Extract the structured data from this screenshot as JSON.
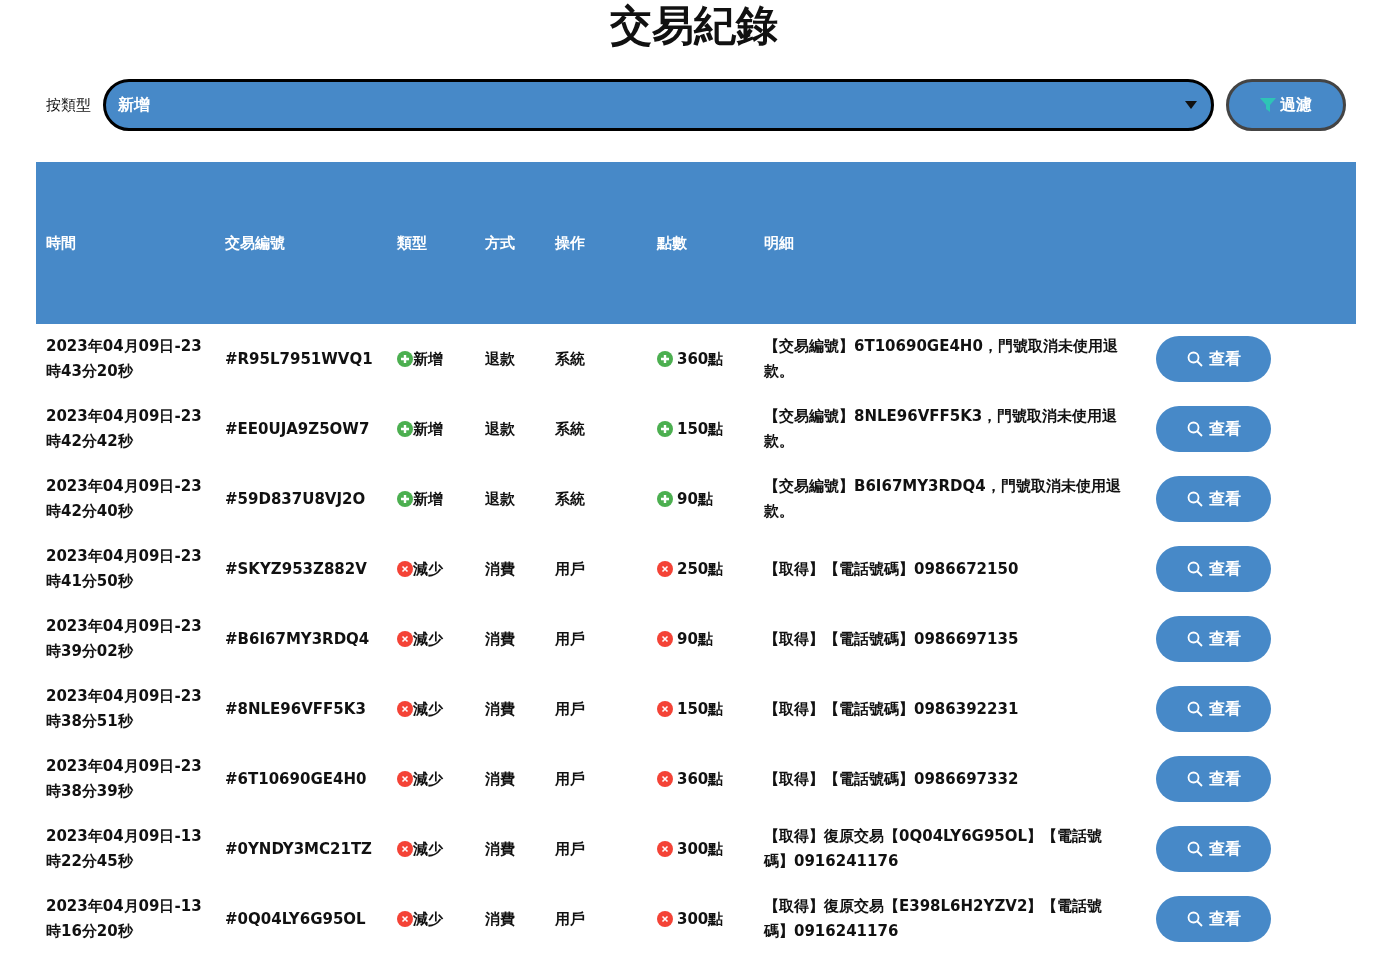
{
  "title": "交易紀錄",
  "filter": {
    "label": "按類型",
    "value": "新增",
    "button": "過濾"
  },
  "table": {
    "columns": [
      "時間",
      "交易編號",
      "類型",
      "方式",
      "操作",
      "點數",
      "明細"
    ],
    "rows": [
      {
        "time_1": "2023年04月09日-23",
        "time_2": "時43分20秒",
        "id": "#R95L7951WVQ1",
        "kind": "add",
        "type": "新增",
        "method": "退款",
        "operator": "系統",
        "points": "360點",
        "detail": "【交易編號】6T10690GE4H0，門號取消未使用退款。",
        "action": "查看"
      },
      {
        "time_1": "2023年04月09日-23",
        "time_2": "時42分42秒",
        "id": "#EE0UJA9Z5OW7",
        "kind": "add",
        "type": "新增",
        "method": "退款",
        "operator": "系統",
        "points": "150點",
        "detail": "【交易編號】8NLE96VFF5K3，門號取消未使用退款。",
        "action": "查看"
      },
      {
        "time_1": "2023年04月09日-23",
        "time_2": "時42分40秒",
        "id": "#59D837U8VJ2O",
        "kind": "add",
        "type": "新增",
        "method": "退款",
        "operator": "系統",
        "points": "90點",
        "detail": "【交易編號】B6I67MY3RDQ4，門號取消未使用退款。",
        "action": "查看"
      },
      {
        "time_1": "2023年04月09日-23",
        "time_2": "時41分50秒",
        "id": "#SKYZ953Z882V",
        "kind": "subtract",
        "type": "減少",
        "method": "消費",
        "operator": "用戶",
        "points": "250點",
        "detail": "【取得】【電話號碼】0986672150",
        "action": "查看"
      },
      {
        "time_1": "2023年04月09日-23",
        "time_2": "時39分02秒",
        "id": "#B6I67MY3RDQ4",
        "kind": "subtract",
        "type": "減少",
        "method": "消費",
        "operator": "用戶",
        "points": "90點",
        "detail": "【取得】【電話號碼】0986697135",
        "action": "查看"
      },
      {
        "time_1": "2023年04月09日-23",
        "time_2": "時38分51秒",
        "id": "#8NLE96VFF5K3",
        "kind": "subtract",
        "type": "減少",
        "method": "消費",
        "operator": "用戶",
        "points": "150點",
        "detail": "【取得】【電話號碼】0986392231",
        "action": "查看"
      },
      {
        "time_1": "2023年04月09日-23",
        "time_2": "時38分39秒",
        "id": "#6T10690GE4H0",
        "kind": "subtract",
        "type": "減少",
        "method": "消費",
        "operator": "用戶",
        "points": "360點",
        "detail": "【取得】【電話號碼】0986697332",
        "action": "查看"
      },
      {
        "time_1": "2023年04月09日-13",
        "time_2": "時22分45秒",
        "id": "#0YNDY3MC21TZ",
        "kind": "subtract",
        "type": "減少",
        "method": "消費",
        "operator": "用戶",
        "points": "300點",
        "detail": "【取得】復原交易【0Q04LY6G95OL】【電話號碼】0916241176",
        "action": "查看"
      },
      {
        "time_1": "2023年04月09日-13",
        "time_2": "時16分20秒",
        "id": "#0Q04LY6G95OL",
        "kind": "subtract",
        "type": "減少",
        "method": "消費",
        "operator": "用戶",
        "points": "300點",
        "detail": "【取得】復原交易【E398L6H2YZV2】【電話號碼】0916241176",
        "action": "查看"
      }
    ]
  }
}
